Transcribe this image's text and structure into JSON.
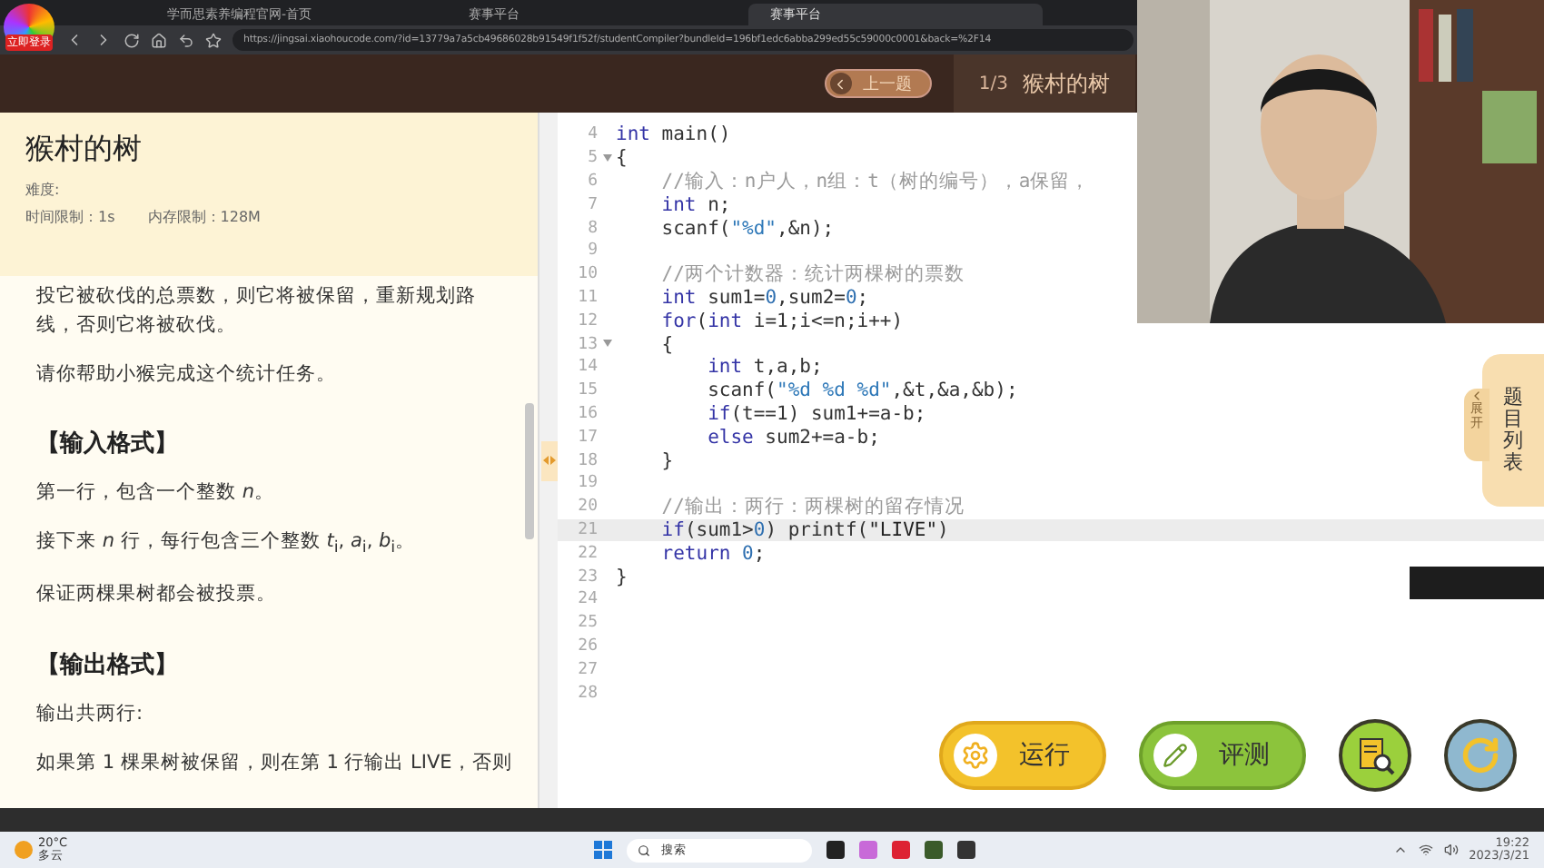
{
  "browser": {
    "tabs": [
      {
        "label": "学而思素养编程官网-首页",
        "selected": false
      },
      {
        "label": "赛事平台",
        "selected": false
      },
      {
        "label": "赛事平台",
        "selected": true
      }
    ],
    "badge": "立即登录",
    "url": "https://jingsai.xiaohoucode.com/?id=13779a7a5cb49686028b91549f1f52f/studentCompiler?bundleId=196bf1edc6abba299ed55c59000c0001&back=%2F14"
  },
  "header": {
    "prev_button": "上一题",
    "counter": "1/3",
    "title": "猴村的树"
  },
  "problem": {
    "title": "猴村的树",
    "difficulty": "难度:",
    "time_limit": "时间限制：1s",
    "memory_limit": "内存限制：128M",
    "blocks": [
      {
        "kind": "para",
        "text": "投它被砍伐的总票数，则它将被保留，重新规划路线，否则它将被砍伐。"
      },
      {
        "kind": "para",
        "text": "请你帮助小猴完成这个统计任务。"
      },
      {
        "kind": "heading",
        "text": "【输入格式】"
      },
      {
        "kind": "para",
        "text": "第一行，包含一个整数 *n*。"
      },
      {
        "kind": "para",
        "text": "接下来 *n* 行，每行包含三个整数 *t*$_{i}$, *a*$_{i}$, *b*$_{i}$。"
      },
      {
        "kind": "para",
        "text": "保证两棵果树都会被投票。"
      },
      {
        "kind": "heading",
        "text": "【输出格式】"
      },
      {
        "kind": "para",
        "text": "输出共两行:"
      },
      {
        "kind": "para",
        "text": "如果第 1 棵果树被保留，则在第 1 行输出 LIVE，否则"
      }
    ]
  },
  "code": [
    {
      "num": "4",
      "fold": false,
      "current": false,
      "tokens": [
        {
          "kind": "kw",
          "text": "int"
        },
        {
          "kind": "tx",
          "text": " main()"
        }
      ]
    },
    {
      "num": "5",
      "fold": true,
      "current": false,
      "tokens": [
        {
          "kind": "tx",
          "text": "{"
        }
      ]
    },
    {
      "num": "6",
      "fold": false,
      "current": false,
      "tokens": [
        {
          "kind": "cm",
          "text": "    //输入：n户人，n组：t（树的编号），a保留，"
        }
      ]
    },
    {
      "num": "7",
      "fold": false,
      "current": false,
      "tokens": [
        {
          "kind": "kw",
          "text": "    int"
        },
        {
          "kind": "tx",
          "text": " n;"
        }
      ]
    },
    {
      "num": "8",
      "fold": false,
      "current": false,
      "tokens": [
        {
          "kind": "tx",
          "text": "    scanf("
        },
        {
          "kind": "str",
          "text": "\"%d\""
        },
        {
          "kind": "tx",
          "text": ",&n);"
        }
      ]
    },
    {
      "num": "9",
      "fold": false,
      "current": false
    },
    {
      "num": "10",
      "fold": false,
      "current": false,
      "tokens": [
        {
          "kind": "cm",
          "text": "    //两个计数器：统计两棵树的票数"
        }
      ]
    },
    {
      "num": "11",
      "fold": false,
      "current": false,
      "tokens": [
        {
          "kind": "kw",
          "text": "    int"
        },
        {
          "kind": "tx",
          "text": " sum1="
        },
        {
          "kind": "num",
          "text": "0"
        },
        {
          "kind": "tx",
          "text": ",sum2="
        },
        {
          "kind": "num",
          "text": "0"
        },
        {
          "kind": "tx",
          "text": ";"
        }
      ]
    },
    {
      "num": "12",
      "fold": false,
      "current": false,
      "tokens": [
        {
          "kind": "kw",
          "text": "    for"
        },
        {
          "kind": "tx",
          "text": "("
        },
        {
          "kind": "kw",
          "text": "int"
        },
        {
          "kind": "tx",
          "text": " i=1;i<=n;i++)"
        }
      ]
    },
    {
      "num": "13",
      "fold": true,
      "current": false,
      "tokens": [
        {
          "kind": "tx",
          "text": "    {"
        }
      ]
    },
    {
      "num": "14",
      "fold": false,
      "current": false,
      "tokens": [
        {
          "kind": "kw",
          "text": "        int"
        },
        {
          "kind": "tx",
          "text": " t,a,b;"
        }
      ]
    },
    {
      "num": "15",
      "fold": false,
      "current": false,
      "tokens": [
        {
          "kind": "tx",
          "text": "        scanf("
        },
        {
          "kind": "str",
          "text": "\"%d %d %d\""
        },
        {
          "kind": "tx",
          "text": ",&t,&a,&b);"
        }
      ]
    },
    {
      "num": "16",
      "fold": false,
      "current": false,
      "tokens": [
        {
          "kind": "kw",
          "text": "        if"
        },
        {
          "kind": "tx",
          "text": "(t==1) sum1+=a-b;"
        }
      ]
    },
    {
      "num": "17",
      "fold": false,
      "current": false,
      "tokens": [
        {
          "kind": "kw",
          "text": "        else"
        },
        {
          "kind": "tx",
          "text": " sum2+=a-b;"
        }
      ]
    },
    {
      "num": "18",
      "fold": false,
      "current": false,
      "tokens": [
        {
          "kind": "tx",
          "text": "    }"
        }
      ]
    },
    {
      "num": "19",
      "fold": false,
      "current": false
    },
    {
      "num": "20",
      "fold": false,
      "current": false,
      "tokens": [
        {
          "kind": "cm",
          "text": "    //输出：两行：两棵树的留存情况"
        }
      ]
    },
    {
      "num": "21",
      "fold": false,
      "current": true,
      "tokens": [
        {
          "kind": "kw",
          "text": "    if"
        },
        {
          "kind": "tx",
          "text": "(sum1>"
        },
        {
          "kind": "num",
          "text": "0"
        },
        {
          "kind": "tx",
          "text": ") printf("
        },
        {
          "kind": "str2",
          "text": "\"LIVE\""
        },
        {
          "kind": "tx",
          "text": ")"
        }
      ]
    },
    {
      "num": "22",
      "fold": false,
      "current": false,
      "tokens": [
        {
          "kind": "kw",
          "text": "    return "
        },
        {
          "kind": "num",
          "text": "0"
        },
        {
          "kind": "tx",
          "text": ";"
        }
      ]
    },
    {
      "num": "23",
      "fold": false,
      "current": false,
      "tokens": [
        {
          "kind": "tx",
          "text": "}"
        }
      ]
    },
    {
      "num": "24",
      "fold": false,
      "current": false
    },
    {
      "num": "25",
      "fold": false,
      "current": false
    },
    {
      "num": "26",
      "fold": false,
      "current": false
    },
    {
      "num": "27",
      "fold": false,
      "current": false
    },
    {
      "num": "28",
      "fold": false,
      "current": false
    }
  ],
  "side_tab": {
    "label": "题目列表",
    "expand": "展开"
  },
  "actions": [
    {
      "kind": "run",
      "label": "运行"
    },
    {
      "kind": "judge",
      "label": "评测"
    },
    {
      "kind": "review"
    },
    {
      "kind": "reset"
    }
  ],
  "taskbar": {
    "temperature": "20°C",
    "weather": "多云",
    "search": "搜索",
    "time": "19:22",
    "date": "2023/3/21"
  }
}
